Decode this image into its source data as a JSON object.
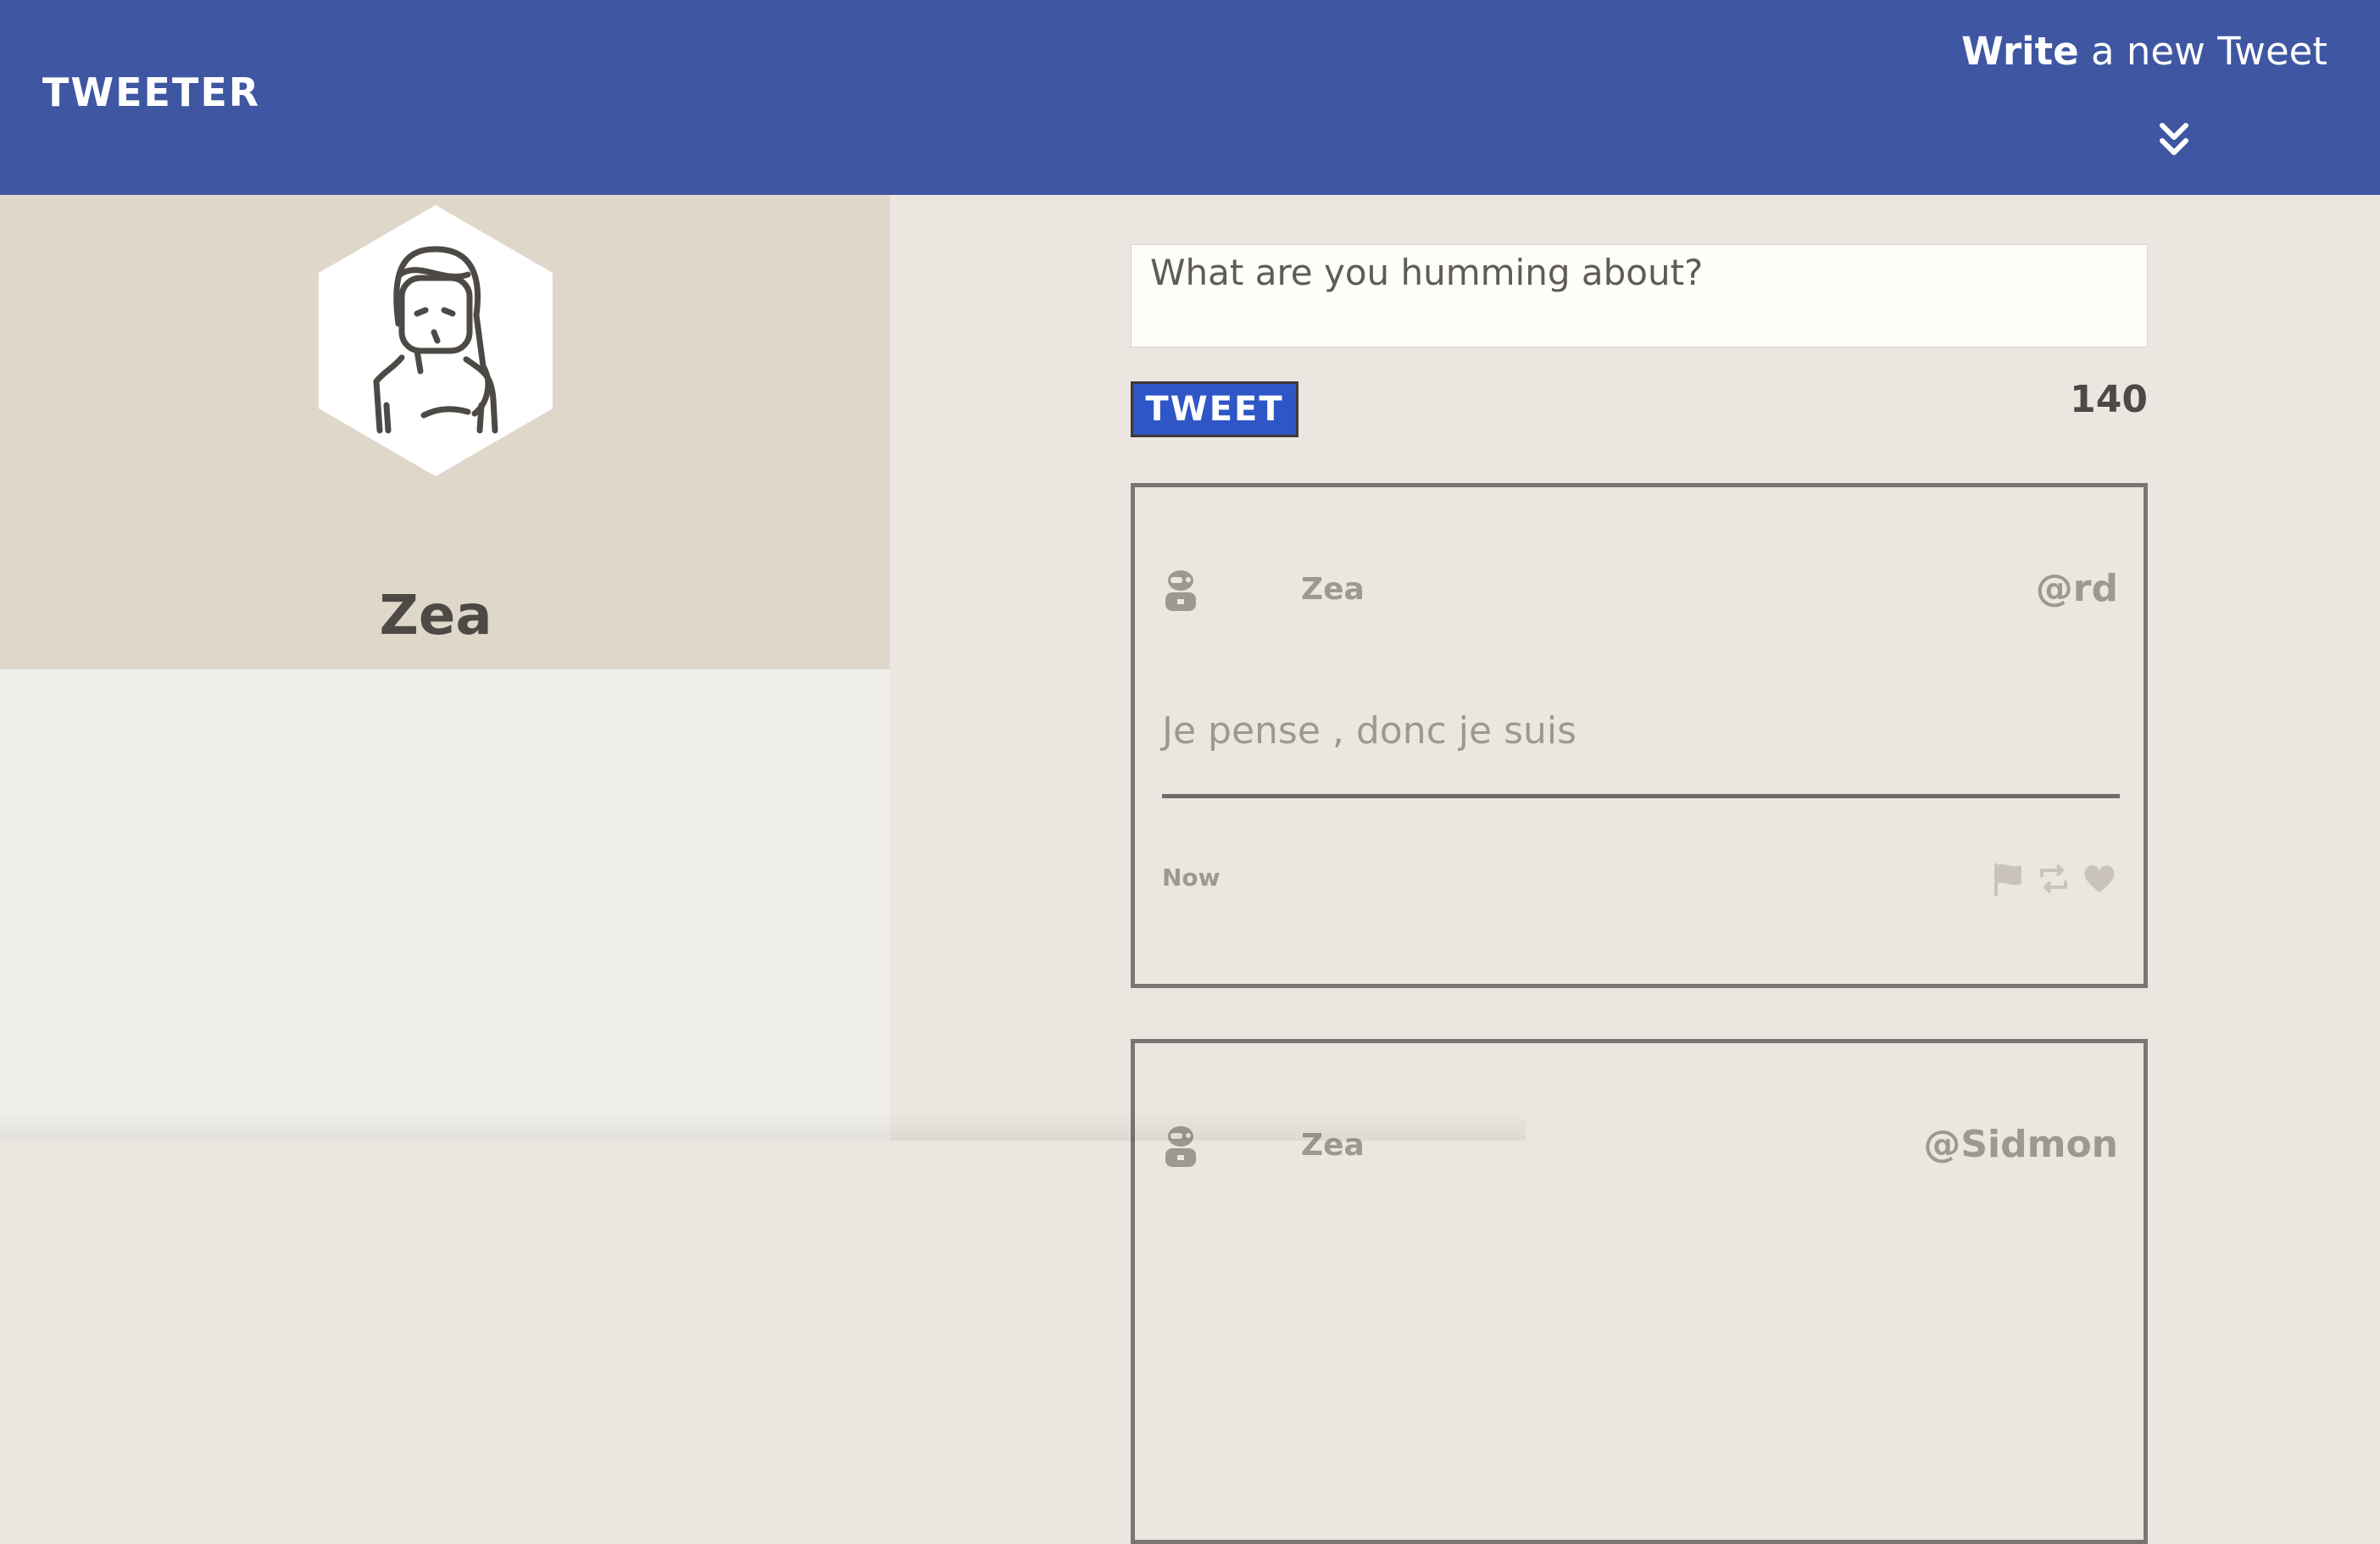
{
  "nav": {
    "brand": "TWEETER",
    "compose_bold": "Write",
    "compose_rest": " a new Tweet",
    "chevron_icon": "double-chevron-down-icon",
    "background": "#3f57a2"
  },
  "profile": {
    "name": "Zea",
    "avatar_icon": "woman-avatar-icon"
  },
  "composer": {
    "placeholder": "What are you humming about?",
    "button_label": "TWEET",
    "counter": "140",
    "button_color": "#2e56c6"
  },
  "tweets": [
    {
      "author": "Zea",
      "handle": "@rd",
      "avatar_icon": "robot-avatar-icon",
      "content": "Je pense , donc je suis",
      "timestamp": "Now",
      "actions": [
        "flag-icon",
        "retweet-icon",
        "heart-icon"
      ]
    },
    {
      "author": "Zea",
      "handle": "@Sidmon",
      "avatar_icon": "robot-avatar-icon"
    }
  ]
}
